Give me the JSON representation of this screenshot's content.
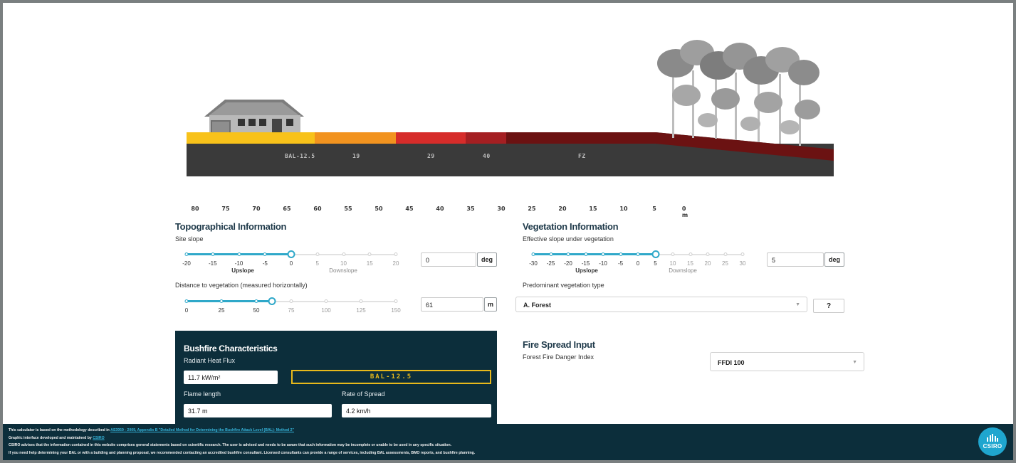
{
  "graphic": {
    "zones": [
      {
        "label": "BAL-12.5",
        "color": "#f8c21a"
      },
      {
        "label": "19",
        "color": "#f2931f"
      },
      {
        "label": "29",
        "color": "#d62c2a"
      },
      {
        "label": "40",
        "color": "#a41f22"
      },
      {
        "label": "FZ",
        "color": "#6b1212"
      }
    ],
    "distance_ticks": [
      "80",
      "75",
      "70",
      "65",
      "60",
      "55",
      "50",
      "45",
      "40",
      "35",
      "30",
      "25",
      "20",
      "15",
      "10",
      "5",
      "0 m"
    ]
  },
  "topographical": {
    "title": "Topographical Information",
    "site_slope": {
      "label": "Site slope",
      "ticks": [
        "-20",
        "-15",
        "-10",
        "-5",
        "0",
        "5",
        "10",
        "15",
        "20"
      ],
      "upslope": "Upslope",
      "downslope": "Downslope",
      "value": "0",
      "unit": "deg"
    },
    "distance": {
      "label": "Distance to vegetation (measured horizontally)",
      "ticks": [
        "0",
        "25",
        "50",
        "75",
        "100",
        "125",
        "150"
      ],
      "value": "61",
      "unit": "m"
    }
  },
  "vegetation": {
    "title": "Vegetation Information",
    "effective_slope": {
      "label": "Effective slope under vegetation",
      "ticks": [
        "-30",
        "-25",
        "-20",
        "-15",
        "-10",
        "-5",
        "0",
        "5",
        "10",
        "15",
        "20",
        "25",
        "30"
      ],
      "upslope": "Upslope",
      "downslope": "Downslope",
      "value": "5",
      "unit": "deg"
    },
    "type": {
      "label": "Predominant vegetation type",
      "selected": "A. Forest",
      "help_label": "?"
    }
  },
  "fire_spread": {
    "title": "Fire Spread Input",
    "ffdi_label": "Forest Fire Danger Index",
    "ffdi_selected": "FFDI 100"
  },
  "bushfire": {
    "title": "Bushfire Characteristics",
    "radiant_label": "Radiant Heat Flux",
    "radiant_value": "11.7 kW/m²",
    "bal_result": "BAL-12.5",
    "flame_label": "Flame length",
    "flame_value": "31.7 m",
    "ros_label": "Rate of Spread",
    "ros_value": "4.2 km/h"
  },
  "footer": {
    "line1_prefix": "This calculator is based on the methodology described in",
    "line1_link": "AS3959 - 2009, Appendix B \"Detailed Method for Determining the Bushfire Attack Level (BAL)- Method 2\"",
    "line2_prefix": "Graphic interface developed and maintained by",
    "line2_link": "CSIRO",
    "line3": "CSIRO advises that the information contained in this website comprises general statements based on scientific research. The user is advised and needs to be aware that such information may be incomplete or unable to be used in any specific situation.",
    "line4": "If you need help determining your BAL or with a building and planning proposal, we recommended contacting an accredited bushfire consultant. Licensed consultants can provide a range of services, including BAL assessments, BMO reports, and bushfire planning.",
    "logo_text": "CSIRO"
  }
}
